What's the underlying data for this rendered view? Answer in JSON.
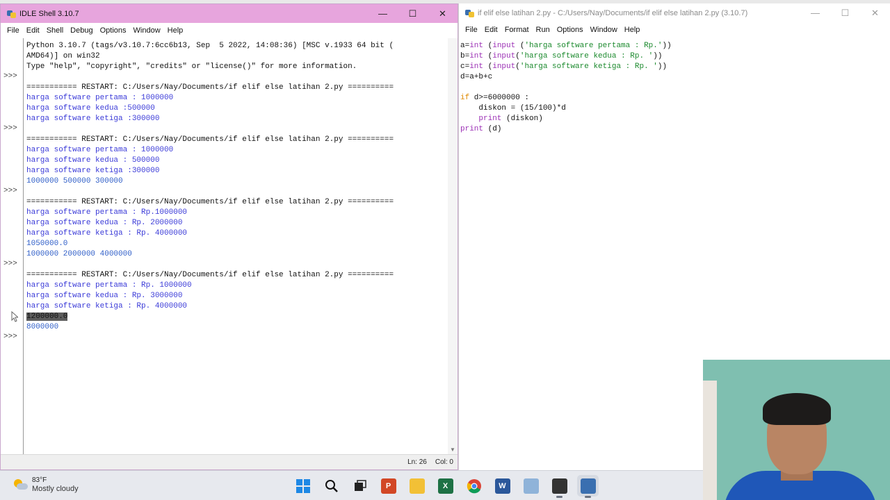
{
  "shell": {
    "title": "IDLE Shell 3.10.7",
    "menu": [
      "File",
      "Edit",
      "Shell",
      "Debug",
      "Options",
      "Window",
      "Help"
    ],
    "prompt": ">>>",
    "lines": [
      {
        "text": "Python 3.10.7 (tags/v3.10.7:6cc6b13, Sep  5 2022, 14:08:36) [MSC v.1933 64 bit (",
        "type": "out"
      },
      {
        "text": "AMD64)] on win32",
        "type": "out"
      },
      {
        "text": "Type \"help\", \"copyright\", \"credits\" or \"license()\" for more information.",
        "type": "out"
      },
      {
        "text": "",
        "type": "out",
        "prompt": true
      },
      {
        "text": "=========== RESTART: C:/Users/Nay/Documents/if elif else latihan 2.py ==========",
        "type": "restart"
      },
      {
        "text": "harga software pertama : 1000000",
        "type": "user"
      },
      {
        "text": "harga software kedua :500000",
        "type": "user"
      },
      {
        "text": "harga software ketiga :300000",
        "type": "user"
      },
      {
        "text": "",
        "type": "out",
        "prompt": true
      },
      {
        "text": "=========== RESTART: C:/Users/Nay/Documents/if elif else latihan 2.py ==========",
        "type": "restart"
      },
      {
        "text": "harga software pertama : 1000000",
        "type": "user"
      },
      {
        "text": "harga software kedua : 500000",
        "type": "user"
      },
      {
        "text": "harga software ketiga :300000",
        "type": "user"
      },
      {
        "text": "1000000 500000 300000",
        "type": "result"
      },
      {
        "text": "",
        "type": "out",
        "prompt": true
      },
      {
        "text": "=========== RESTART: C:/Users/Nay/Documents/if elif else latihan 2.py ==========",
        "type": "restart"
      },
      {
        "text": "harga software pertama : Rp.1000000",
        "type": "user"
      },
      {
        "text": "harga software kedua : Rp. 2000000",
        "type": "user"
      },
      {
        "text": "harga software ketiga : Rp. 4000000",
        "type": "user"
      },
      {
        "text": "1050000.0",
        "type": "result"
      },
      {
        "text": "1000000 2000000 4000000",
        "type": "result"
      },
      {
        "text": "",
        "type": "out",
        "prompt": true
      },
      {
        "text": "=========== RESTART: C:/Users/Nay/Documents/if elif else latihan 2.py ==========",
        "type": "restart"
      },
      {
        "text": "harga software pertama : Rp. 1000000",
        "type": "user"
      },
      {
        "text": "harga software kedua : Rp. 3000000",
        "type": "user"
      },
      {
        "text": "harga software ketiga : Rp. 4000000",
        "type": "user"
      },
      {
        "text": "1200000.0",
        "type": "sel"
      },
      {
        "text": "8000000",
        "type": "result"
      },
      {
        "text": "",
        "type": "out",
        "prompt": true
      }
    ],
    "status": {
      "line": "Ln: 26",
      "col": "Col: 0"
    }
  },
  "editor": {
    "title": "if elif else latihan 2.py - C:/Users/Nay/Documents/if elif else latihan 2.py (3.10.7)",
    "menu": [
      "File",
      "Edit",
      "Format",
      "Run",
      "Options",
      "Window",
      "Help"
    ],
    "code": [
      [
        {
          "t": "a=",
          "c": "n"
        },
        {
          "t": "int",
          "c": "bi"
        },
        {
          "t": " (",
          "c": "n"
        },
        {
          "t": "input",
          "c": "bi"
        },
        {
          "t": " (",
          "c": "n"
        },
        {
          "t": "'harga software pertama : Rp.'",
          "c": "str"
        },
        {
          "t": "))",
          "c": "n"
        }
      ],
      [
        {
          "t": "b=",
          "c": "n"
        },
        {
          "t": "int",
          "c": "bi"
        },
        {
          "t": " (",
          "c": "n"
        },
        {
          "t": "input",
          "c": "bi"
        },
        {
          "t": "(",
          "c": "n"
        },
        {
          "t": "'harga software kedua : Rp. '",
          "c": "str"
        },
        {
          "t": "))",
          "c": "n"
        }
      ],
      [
        {
          "t": "c=",
          "c": "n"
        },
        {
          "t": "int",
          "c": "bi"
        },
        {
          "t": " (",
          "c": "n"
        },
        {
          "t": "input",
          "c": "bi"
        },
        {
          "t": "(",
          "c": "n"
        },
        {
          "t": "'harga software ketiga : Rp. '",
          "c": "str"
        },
        {
          "t": "))",
          "c": "n"
        }
      ],
      [
        {
          "t": "d=a+b+c",
          "c": "n"
        }
      ],
      [
        {
          "t": "",
          "c": "n"
        }
      ],
      [
        {
          "t": "if",
          "c": "kw"
        },
        {
          "t": " d>=6000000 :",
          "c": "n"
        }
      ],
      [
        {
          "t": "    diskon = (15/100)*d",
          "c": "n"
        }
      ],
      [
        {
          "t": "    ",
          "c": "n"
        },
        {
          "t": "print",
          "c": "bi"
        },
        {
          "t": " (diskon)",
          "c": "n"
        }
      ],
      [
        {
          "t": "print",
          "c": "bi"
        },
        {
          "t": " (d)",
          "c": "n"
        }
      ]
    ]
  },
  "taskbar": {
    "weather_temp": "83°F",
    "weather_desc": "Mostly cloudy",
    "icons": [
      {
        "name": "windows-start-icon",
        "label": "",
        "bg": "#1e88e5"
      },
      {
        "name": "search-icon",
        "label": "",
        "bg": "transparent"
      },
      {
        "name": "task-view-icon",
        "label": "",
        "bg": "transparent"
      },
      {
        "name": "powerpoint-icon",
        "label": "P",
        "bg": "#d24726"
      },
      {
        "name": "file-explorer-icon",
        "label": "",
        "bg": "#f2c036"
      },
      {
        "name": "excel-icon",
        "label": "X",
        "bg": "#1e7145"
      },
      {
        "name": "chrome-icon",
        "label": "",
        "bg": "#db4437"
      },
      {
        "name": "word-icon",
        "label": "W",
        "bg": "#2b579a"
      },
      {
        "name": "notepad-icon",
        "label": "",
        "bg": "#8fb3d9"
      },
      {
        "name": "app-icon",
        "label": "",
        "bg": "#333333"
      },
      {
        "name": "python-idle-icon",
        "label": "",
        "bg": "#3a6fb0"
      }
    ]
  }
}
